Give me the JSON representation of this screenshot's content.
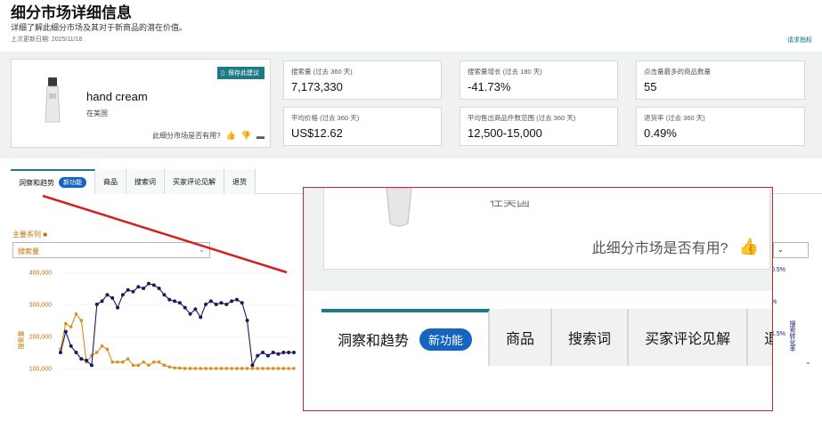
{
  "header": {
    "title": "细分市场详细信息",
    "subtitle": "详细了解此细分市场及其对于新商品的潜在价值。",
    "last_updated": "上次更新日期: 2025/11/16",
    "request_link": "请求指标"
  },
  "product": {
    "name": "hand cream",
    "location": "在美国",
    "save_button": "保存此建议",
    "useful_question": "此细分市场是否有用?"
  },
  "metrics": [
    {
      "label": "搜索量 (过去 360 天)",
      "value": "7,173,330"
    },
    {
      "label": "搜索量增长 (过去 180 天)",
      "value": "-41.73%"
    },
    {
      "label": "点击量最多的商品数量",
      "value": "55"
    },
    {
      "label": "平均价格 (过去 360 天)",
      "value": "US$12.62"
    },
    {
      "label": "平均售出商品件数范围 (过去 360 天)",
      "value": "12,500-15,000"
    },
    {
      "label": "退货率 (过去 360 天)",
      "value": "0.49%"
    }
  ],
  "tabs": [
    {
      "label": "洞察和趋势",
      "badge": "新功能"
    },
    {
      "label": "商品"
    },
    {
      "label": "搜索词"
    },
    {
      "label": "买家评论见解"
    },
    {
      "label": "退货"
    }
  ],
  "chart_controls": {
    "series_label": "主要系列 ■",
    "series_value": "搜索量",
    "right_axis_ticks": [
      "0.5%",
      "%",
      "1.5%",
      "%"
    ],
    "right_axis_title": "搜索转化率"
  },
  "chart_data": {
    "type": "line",
    "ylabel": "搜索量",
    "y_ticks": [
      "400,000",
      "300,000",
      "200,000",
      "100,000"
    ],
    "ylim": [
      100000,
      400000
    ],
    "series": [
      {
        "name": "",
        "color": "#d98b1f",
        "values": [
          160000,
          240000,
          230000,
          270000,
          250000,
          120000,
          140000,
          150000,
          170000,
          160000,
          120000,
          120000,
          120000,
          130000,
          110000,
          110000,
          120000,
          110000,
          120000,
          120000,
          110000,
          105000,
          102000,
          101000,
          100000,
          100000,
          100000,
          100000,
          100000,
          100000,
          100000,
          100000,
          100000,
          100000,
          100000,
          100000,
          100000,
          100000,
          100000,
          100000,
          100000,
          100000,
          100000,
          100000,
          100000,
          100000
        ]
      },
      {
        "name": "",
        "color": "#1a1a5e",
        "values": [
          150000,
          215000,
          170000,
          150000,
          130000,
          125000,
          110000,
          300000,
          310000,
          330000,
          320000,
          290000,
          330000,
          345000,
          340000,
          355000,
          350000,
          365000,
          360000,
          350000,
          330000,
          315000,
          310000,
          305000,
          290000,
          270000,
          285000,
          260000,
          300000,
          310000,
          300000,
          305000,
          300000,
          310000,
          315000,
          305000,
          250000,
          110000,
          140000,
          150000,
          140000,
          150000,
          145000,
          150000,
          150000,
          150000
        ]
      }
    ]
  },
  "zoom": {
    "location": "在美国",
    "useful_question": "此细分市场是否有用?",
    "tabs": [
      {
        "label": "洞察和趋势",
        "badge": "新功能"
      },
      {
        "label": "商品"
      },
      {
        "label": "搜索词"
      },
      {
        "label": "买家评论见解"
      },
      {
        "label": "退"
      }
    ]
  }
}
